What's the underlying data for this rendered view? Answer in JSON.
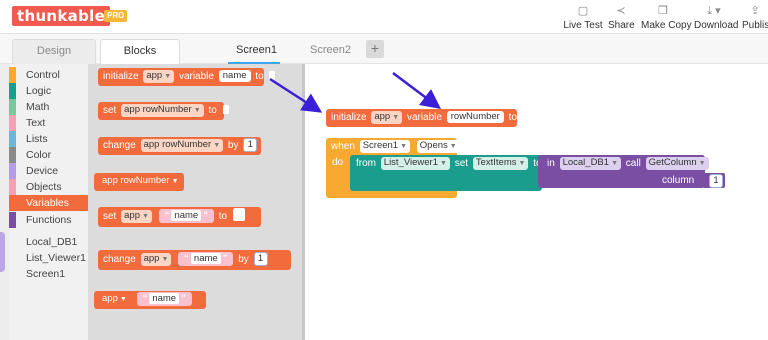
{
  "app": {
    "logo": "thunkable",
    "badge": "PRO"
  },
  "toolbar": [
    {
      "label": "Live Test",
      "icon": "live-test-icon",
      "glyph": "▢"
    },
    {
      "label": "Share",
      "icon": "share-icon",
      "glyph": "≺"
    },
    {
      "label": "Make Copy",
      "icon": "copy-icon",
      "glyph": "❐"
    },
    {
      "label": "Download",
      "icon": "download-icon",
      "glyph": "⤓ ▾"
    },
    {
      "label": "Publish",
      "icon": "publish-icon",
      "glyph": "⇪"
    }
  ],
  "tabs": {
    "design": "Design",
    "blocks": "Blocks"
  },
  "screens": [
    "Screen1",
    "Screen2"
  ],
  "add_screen": "+",
  "categories": [
    {
      "label": "Control",
      "color": "#f7a932"
    },
    {
      "label": "Logic",
      "color": "#1a9d8c"
    },
    {
      "label": "Math",
      "color": "#7ac79c"
    },
    {
      "label": "Text",
      "color": "#f6a0b4"
    },
    {
      "label": "Lists",
      "color": "#6db6d6"
    },
    {
      "label": "Color",
      "color": "#8a8a8a"
    },
    {
      "label": "Device",
      "color": "#b49ce8"
    },
    {
      "label": "Objects",
      "color": "#f6a0b4"
    },
    {
      "label": "Variables",
      "color": "#f26b3c"
    },
    {
      "label": "Functions",
      "color": "#7a4fa3"
    }
  ],
  "components": [
    "Local_DB1",
    "List_Viewer1",
    "Screen1"
  ],
  "flyout": {
    "b1": {
      "kw": "initialize",
      "scope": "app",
      "kw2": "variable",
      "name": "name",
      "kw3": "to"
    },
    "b2": {
      "kw": "set",
      "var": "app rowNumber",
      "kw2": "to"
    },
    "b3": {
      "kw": "change",
      "var": "app rowNumber",
      "kw2": "by",
      "num": "1"
    },
    "b4": {
      "var": "app rowNumber"
    },
    "b5": {
      "kw": "set",
      "scope": "app",
      "str": "name",
      "kw2": "to"
    },
    "b6": {
      "kw": "change",
      "scope": "app",
      "str": "name",
      "kw2": "by",
      "num": "1"
    },
    "b7": {
      "scope": "app",
      "str": "name"
    }
  },
  "workspace": {
    "init": {
      "kw": "initialize",
      "scope": "app",
      "kw2": "variable",
      "name": "rowNumber",
      "kw3": "to"
    },
    "event": {
      "when": "when",
      "component": "Screen1",
      "event": "Opens",
      "do": "do"
    },
    "setter": {
      "from": "from",
      "component": "List_Viewer1",
      "set": "set",
      "prop": "TextItems",
      "to": "to"
    },
    "call": {
      "in": "in",
      "component": "Local_DB1",
      "call": "call",
      "method": "GetColumn",
      "arg": "column",
      "num": "1"
    }
  },
  "colors": {
    "brand": "#f05a4f",
    "pro": "#f4b73a",
    "variables": "#f26b3c",
    "control": "#f7a932",
    "ui": "#1a9d8c",
    "db": "#7a4fa3",
    "arrow": "#3b1fd6",
    "tab_accent": "#3ea6f0"
  }
}
